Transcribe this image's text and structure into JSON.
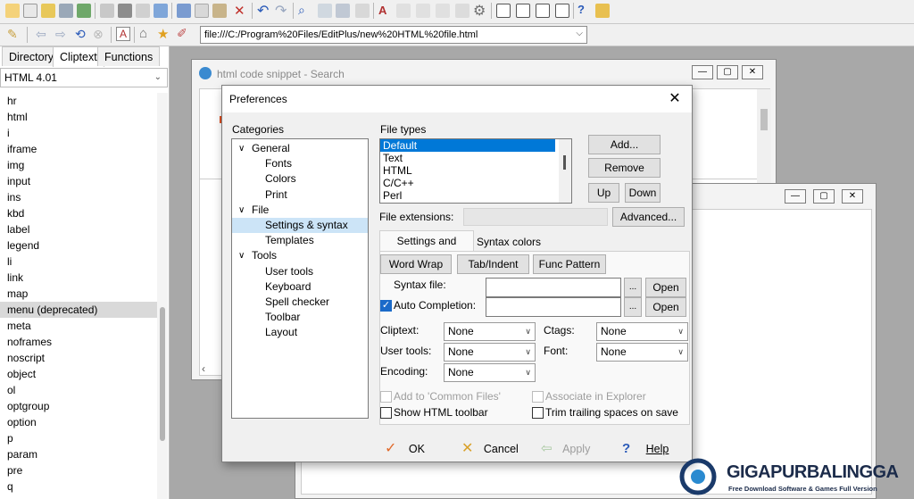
{
  "toolbar2": {
    "url": "file:///C:/Program%20Files/EditPlus/new%20HTML%20file.html"
  },
  "left_panel": {
    "tabs": [
      "Directory",
      "Cliptext",
      "Functions"
    ],
    "active_tab": "Cliptext",
    "language": "HTML 4.01",
    "tags": [
      "hr",
      "html",
      "i",
      "iframe",
      "img",
      "input",
      "ins",
      "kbd",
      "label",
      "legend",
      "li",
      "link",
      "map",
      "menu (deprecated)",
      "meta",
      "noframes",
      "noscript",
      "object",
      "ol",
      "optgroup",
      "option",
      "p",
      "param",
      "pre",
      "q"
    ],
    "selected_tag": "menu (deprecated)"
  },
  "bg_window": {
    "title": "html code snippet - Search"
  },
  "dialog": {
    "title": "Preferences",
    "close_label": "✕",
    "categories_label": "Categories",
    "tree": [
      {
        "label": "General",
        "level": 0,
        "expanded": true
      },
      {
        "label": "Fonts",
        "level": 1
      },
      {
        "label": "Colors",
        "level": 1
      },
      {
        "label": "Print",
        "level": 1
      },
      {
        "label": "File",
        "level": 0,
        "expanded": true
      },
      {
        "label": "Settings & syntax",
        "level": 1,
        "selected": true
      },
      {
        "label": "Templates",
        "level": 1
      },
      {
        "label": "Tools",
        "level": 0,
        "expanded": true
      },
      {
        "label": "User tools",
        "level": 1
      },
      {
        "label": "Keyboard",
        "level": 1
      },
      {
        "label": "Spell checker",
        "level": 1
      },
      {
        "label": "Toolbar",
        "level": 1
      },
      {
        "label": "Layout",
        "level": 1
      }
    ],
    "file_types_label": "File types",
    "file_types": [
      "Default",
      "Text",
      "HTML",
      "C/C++",
      "Perl"
    ],
    "selected_file_type": "Default",
    "buttons": {
      "add": "Add...",
      "remove": "Remove",
      "up": "Up",
      "down": "Down",
      "advanced": "Advanced..."
    },
    "file_extensions_label": "File extensions:",
    "subtabs": [
      "Settings and syntax",
      "Syntax colors"
    ],
    "sub_buttons": {
      "word_wrap": "Word Wrap",
      "tab_indent": "Tab/Indent",
      "func_pattern": "Func Pattern"
    },
    "syntax_file_label": "Syntax file:",
    "auto_completion_label": "Auto Completion:",
    "auto_completion_checked": true,
    "browse_label": "...",
    "open_label": "Open",
    "cliptext_label": "Cliptext:",
    "ctags_label": "Ctags:",
    "user_tools_label": "User tools:",
    "font_label": "Font:",
    "encoding_label": "Encoding:",
    "none_value": "None",
    "add_common_files": "Add to 'Common Files'",
    "associate_explorer": "Associate in Explorer",
    "show_html_toolbar": "Show HTML toolbar",
    "trim_trailing": "Trim trailing spaces on save",
    "footer": {
      "ok": "OK",
      "cancel": "Cancel",
      "apply": "Apply",
      "help": "Help"
    },
    "colors": {
      "accent": "#1b6ac9",
      "ok_check": "#e0692a",
      "cancel_x": "#d9a12a"
    }
  },
  "watermark": {
    "brand": "GIGAPURBALINGGA",
    "tagline": "Free Download Software & Games Full Version"
  }
}
